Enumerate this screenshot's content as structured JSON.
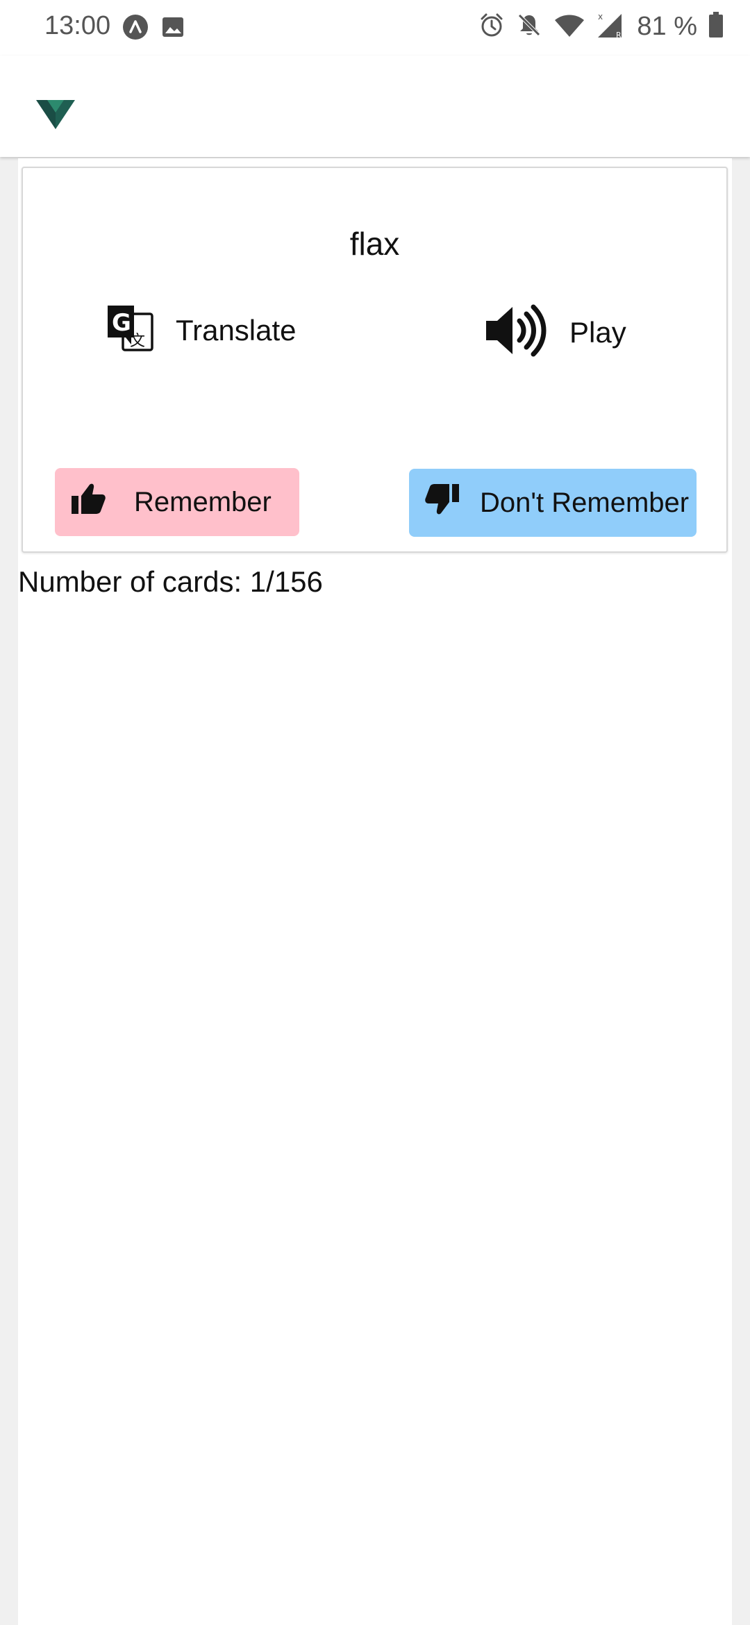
{
  "status_bar": {
    "time": "13:00",
    "left_icons": [
      "app-notification-icon",
      "image-icon"
    ],
    "right_icons": [
      "alarm-icon",
      "notifications-off-icon",
      "wifi-icon",
      "cellular-signal-icon"
    ],
    "battery_text": "81 %"
  },
  "app_bar": {
    "logo_icon": "vuetify-logo-icon"
  },
  "card": {
    "word": "flax",
    "translate": {
      "icon": "google-translate-icon",
      "label": "Translate"
    },
    "play": {
      "icon": "volume-up-icon",
      "label": "Play"
    },
    "remember": {
      "icon": "thumbs-up-icon",
      "label": "Remember",
      "color": "#ffc0cb"
    },
    "dont_remember": {
      "icon": "thumbs-down-icon",
      "label": "Don't Remember",
      "color": "#90cdfa"
    }
  },
  "footer": {
    "card_count": "Number of cards: 1/156"
  },
  "colors": {
    "logo_dark": "#1a4d45",
    "logo_light": "#2c8a6e",
    "app_bg": "#f0f0f0"
  }
}
